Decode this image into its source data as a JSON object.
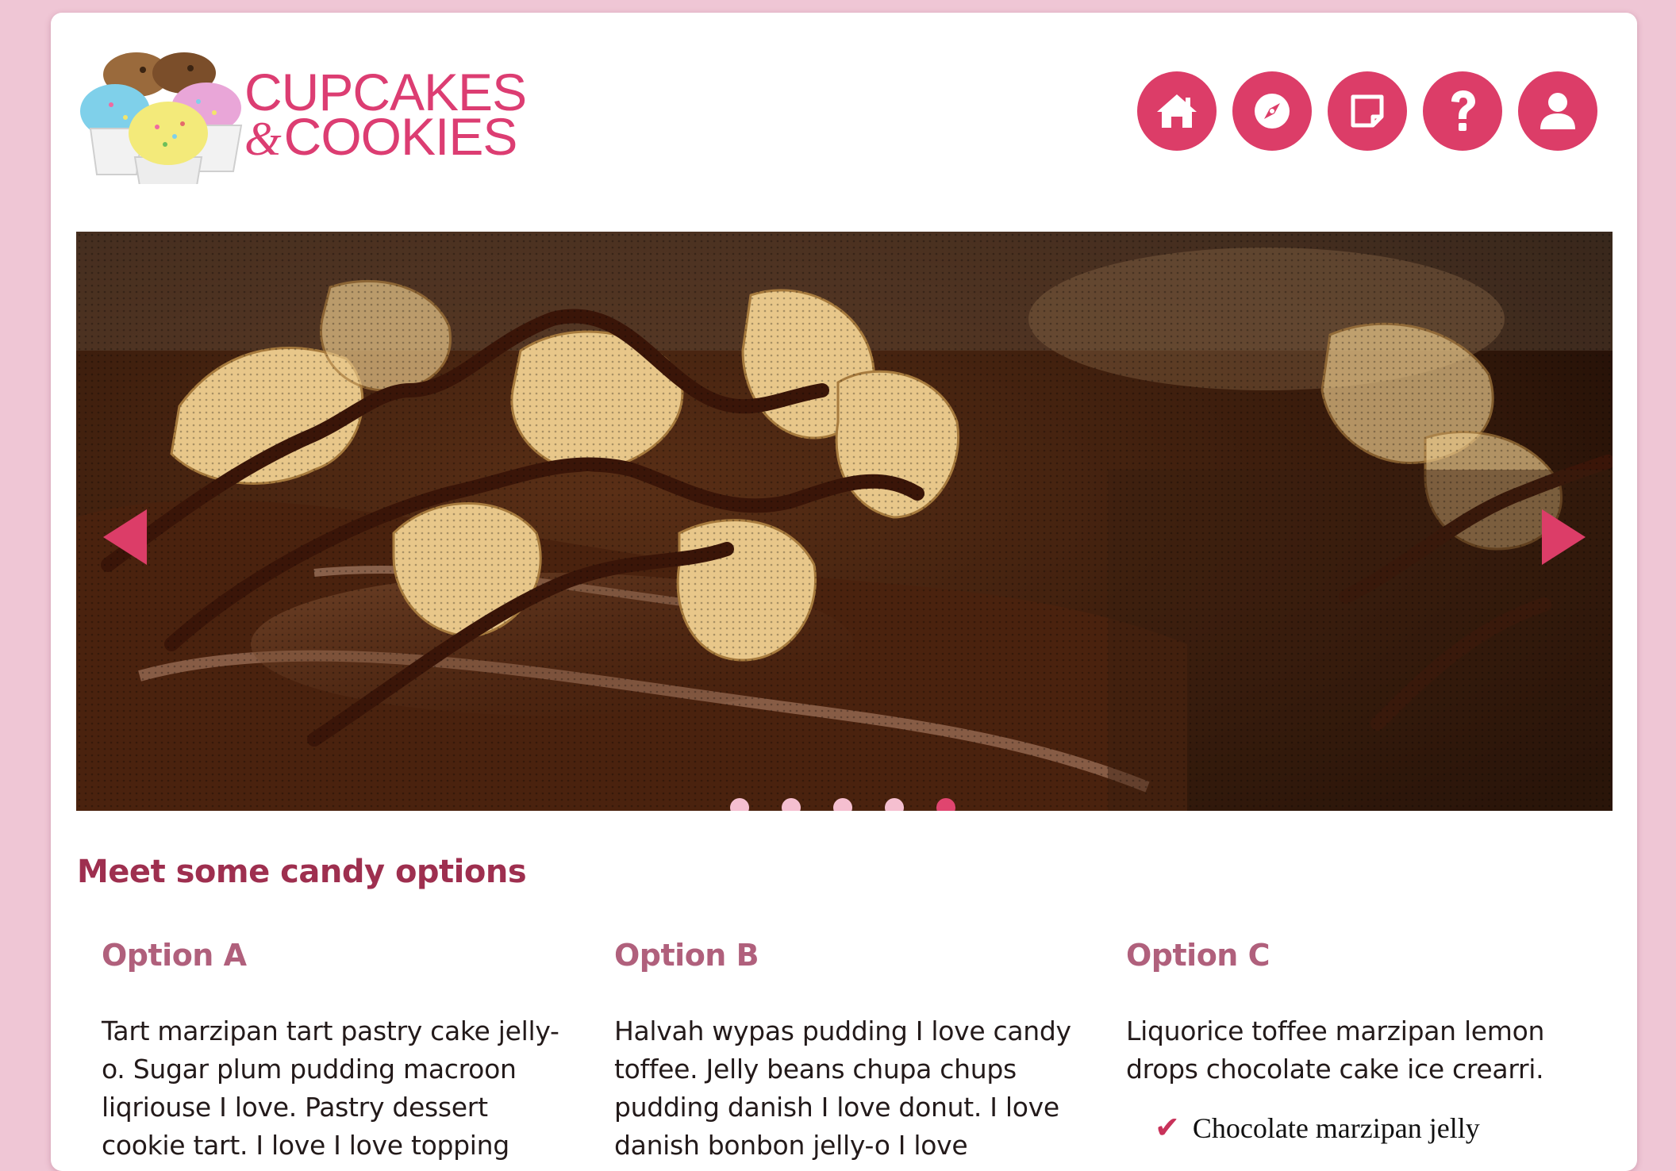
{
  "brand": {
    "line1": "CUPCAKES",
    "amp": "&",
    "line2": "COOKIES",
    "accent": "#dc3d68",
    "title_color": "#9e2f4f",
    "subtitle_color": "#b0607c"
  },
  "nav": [
    {
      "icon": "home-icon"
    },
    {
      "icon": "compass-icon"
    },
    {
      "icon": "note-icon"
    },
    {
      "icon": "help-icon"
    },
    {
      "icon": "user-icon"
    }
  ],
  "carousel": {
    "slide_count": 5,
    "active_index": 4,
    "prev_icon": "triangle-left-icon",
    "next_icon": "triangle-right-icon"
  },
  "section": {
    "title": "Meet some candy options"
  },
  "options": [
    {
      "title": "Option A",
      "text": "Tart marzipan tart pastry cake jelly-o. Sugar plum pudding macroon liqriouse I love. Pastry dessert cookie tart. I love I love topping"
    },
    {
      "title": "Option B",
      "text": "Halvah wypas pudding I love candy toffee. Jelly beans chupa chups pudding danish I love donut. I love danish bonbon jelly-o I love"
    },
    {
      "title": "Option C",
      "text": "Liquorice toffee marzipan lemon drops chocolate cake ice crearri.",
      "list": [
        "Chocolate marzipan jelly"
      ]
    }
  ]
}
